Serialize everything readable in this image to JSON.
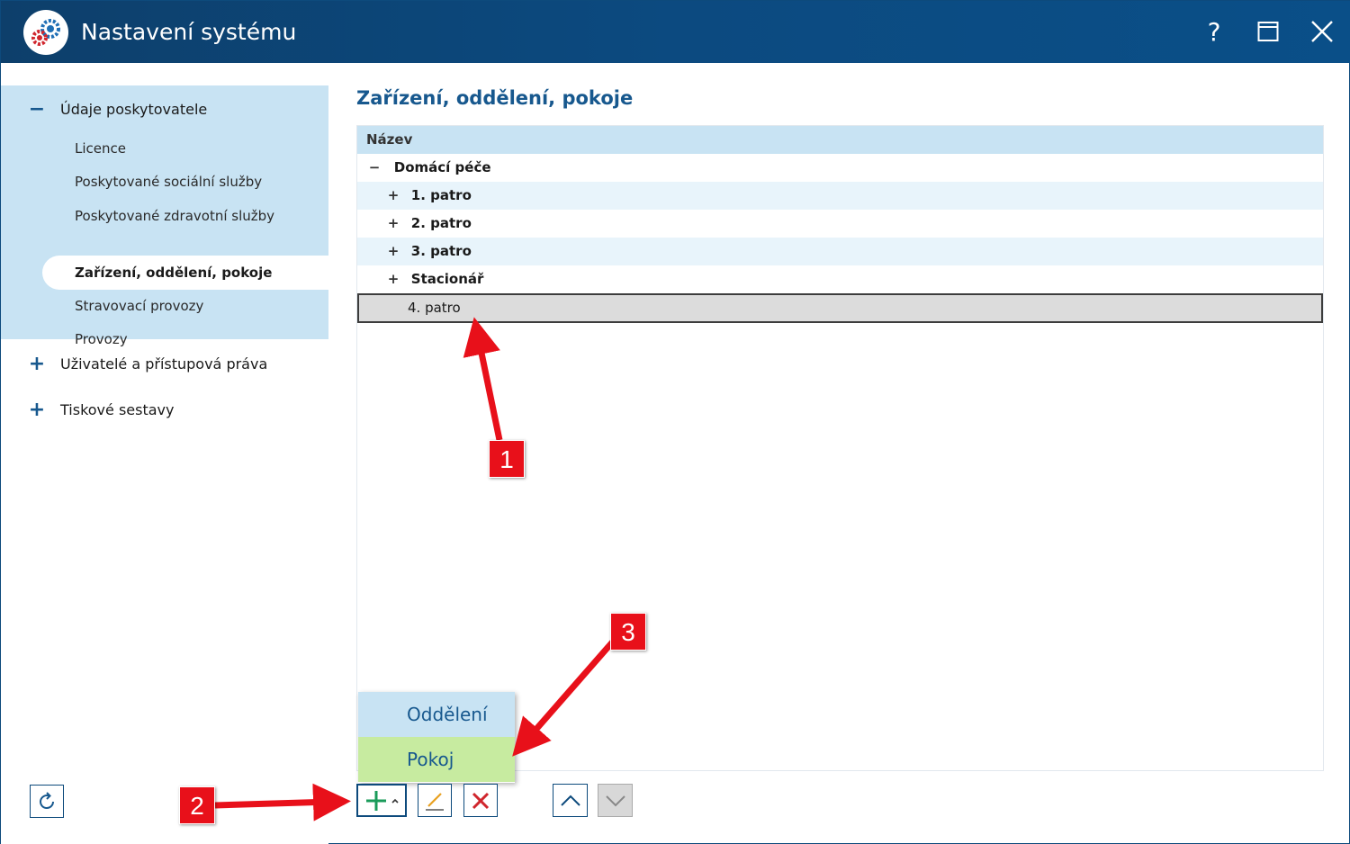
{
  "window": {
    "title": "Nastavení systému",
    "help_glyph": "?",
    "icons": [
      "app-gears-icon",
      "help-icon",
      "maximize-icon",
      "close-icon"
    ]
  },
  "sidebar": {
    "groups": [
      {
        "sign": "−",
        "label": "Údaje poskytovatele",
        "expanded": true,
        "items": [
          "Licence",
          "Poskytované sociální služby",
          "Poskytované zdravotní služby",
          "Zařízení, oddělení, pokoje",
          "Stravovací provozy",
          "Provozy"
        ],
        "active_index": 3
      },
      {
        "sign": "+",
        "label": "Uživatelé a přístupová práva",
        "expanded": false
      },
      {
        "sign": "+",
        "label": "Tiskové sestavy",
        "expanded": false
      }
    ]
  },
  "main": {
    "title": "Zařízení, oddělení, pokoje",
    "grid": {
      "column_header": "Název",
      "rows": [
        {
          "sign": "−",
          "label": "Domácí péče",
          "level": 0
        },
        {
          "sign": "+",
          "label": "1. patro",
          "level": 1
        },
        {
          "sign": "+",
          "label": "2. patro",
          "level": 1
        },
        {
          "sign": "+",
          "label": "3. patro",
          "level": 1
        },
        {
          "sign": "+",
          "label": "Stacionář",
          "level": 1
        },
        {
          "sign": "",
          "label": "4. patro",
          "level": 1,
          "selected": true
        }
      ]
    },
    "add_menu": {
      "items": [
        "Oddělení",
        "Pokoj"
      ],
      "highlighted": "Pokoj"
    },
    "toolbar": {
      "buttons": [
        "add-icon",
        "edit-icon",
        "delete-icon",
        "move-up-icon",
        "move-down-icon"
      ]
    }
  },
  "annotations": {
    "badge_1": "1",
    "badge_2": "2",
    "badge_3": "3",
    "color": "#e8101a"
  },
  "colors": {
    "titlebar": "#0c4a80",
    "accent": "#17588e",
    "sidebar_group": "#c8e3f3",
    "menu_highlight": "#c7eba0"
  }
}
